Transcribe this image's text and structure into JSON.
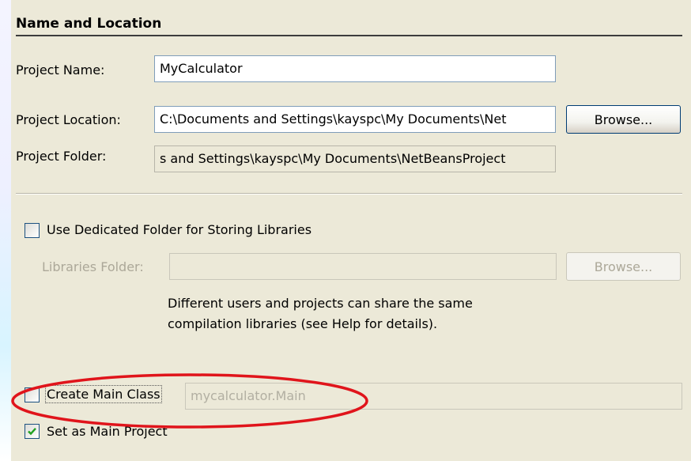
{
  "section": {
    "title": "Name and Location"
  },
  "project_name": {
    "label": "Project Name:",
    "value": "MyCalculator"
  },
  "project_location": {
    "label": "Project Location:",
    "value": "C:\\Documents and Settings\\kayspc\\My Documents\\Net",
    "browse_label": "Browse..."
  },
  "project_folder": {
    "label": "Project Folder:",
    "value": "s and Settings\\kayspc\\My Documents\\NetBeansProject"
  },
  "libraries": {
    "dedicated_checkbox_label": "Use Dedicated Folder for Storing Libraries",
    "dedicated_checked": false,
    "folder_label": "Libraries Folder:",
    "folder_value": "",
    "browse_label": "Browse...",
    "help_line1": "Different users and projects can share the same",
    "help_line2": "compilation libraries (see Help for details)."
  },
  "main_class": {
    "checkbox_label": "Create Main Class",
    "checked": false,
    "value": "mycalculator.Main"
  },
  "main_project": {
    "checkbox_label": "Set as Main Project",
    "checked": true
  },
  "colors": {
    "background": "#ece9d8",
    "highlight_ellipse": "#e0141b",
    "field_border": "#7f9db9"
  }
}
